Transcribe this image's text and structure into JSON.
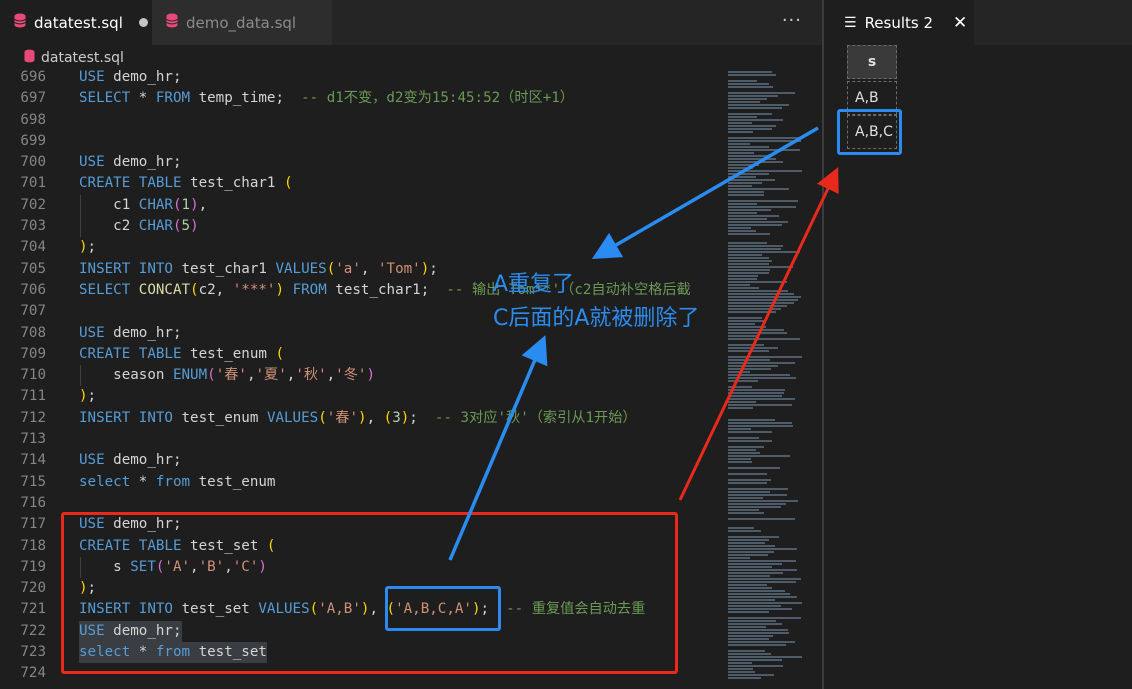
{
  "tabs": [
    {
      "label": "datatest.sql",
      "active": true,
      "modified": true
    },
    {
      "label": "demo_data.sql",
      "active": false,
      "modified": false
    }
  ],
  "breadcrumb": "datatest.sql",
  "more_label": "···",
  "editor_lines": [
    {
      "n": "696",
      "tokens": [
        [
          "kw",
          "USE"
        ],
        [
          "id",
          " demo_hr;"
        ]
      ]
    },
    {
      "n": "697",
      "tokens": [
        [
          "kw",
          "SELECT"
        ],
        [
          "id",
          " * "
        ],
        [
          "kw",
          "FROM"
        ],
        [
          "id",
          " temp_time;  "
        ],
        [
          "cm",
          "-- d1不变，d2变为15:45:52（时区+1）"
        ]
      ]
    },
    {
      "n": "698",
      "tokens": []
    },
    {
      "n": "699",
      "tokens": []
    },
    {
      "n": "700",
      "tokens": [
        [
          "kw",
          "USE"
        ],
        [
          "id",
          " demo_hr;"
        ]
      ]
    },
    {
      "n": "701",
      "tokens": [
        [
          "kw",
          "CREATE TABLE"
        ],
        [
          "id",
          " test_char1 "
        ],
        [
          "p1",
          "("
        ]
      ]
    },
    {
      "n": "702",
      "guide": true,
      "tokens": [
        [
          "id",
          "    c1 "
        ],
        [
          "kw",
          "CHAR"
        ],
        [
          "p2",
          "("
        ],
        [
          "num",
          "1"
        ],
        [
          "p2",
          ")"
        ],
        [
          "id",
          ","
        ]
      ]
    },
    {
      "n": "703",
      "guide": true,
      "tokens": [
        [
          "id",
          "    c2 "
        ],
        [
          "kw",
          "CHAR"
        ],
        [
          "p2",
          "("
        ],
        [
          "num",
          "5"
        ],
        [
          "p2",
          ")"
        ]
      ]
    },
    {
      "n": "704",
      "tokens": [
        [
          "p1",
          ")"
        ],
        [
          "id",
          ";"
        ]
      ]
    },
    {
      "n": "705",
      "tokens": [
        [
          "kw",
          "INSERT INTO"
        ],
        [
          "id",
          " test_char1 "
        ],
        [
          "kw",
          "VALUES"
        ],
        [
          "p1",
          "("
        ],
        [
          "str",
          "'a'"
        ],
        [
          "id",
          ", "
        ],
        [
          "str",
          "'Tom'"
        ],
        [
          "p1",
          ")"
        ],
        [
          "id",
          ";"
        ]
      ]
    },
    {
      "n": "706",
      "tokens": [
        [
          "kw",
          "SELECT"
        ],
        [
          "id",
          " "
        ],
        [
          "fn",
          "CONCAT"
        ],
        [
          "p1",
          "("
        ],
        [
          "id",
          "c2, "
        ],
        [
          "str",
          "'***'"
        ],
        [
          "p1",
          ")"
        ],
        [
          "id",
          " "
        ],
        [
          "kw",
          "FROM"
        ],
        [
          "id",
          " test_char1;  "
        ],
        [
          "cm",
          "-- 输出'Tom**'（c2自动补空格后截"
        ]
      ]
    },
    {
      "n": "707",
      "tokens": []
    },
    {
      "n": "708",
      "tokens": [
        [
          "kw",
          "USE"
        ],
        [
          "id",
          " demo_hr;"
        ]
      ]
    },
    {
      "n": "709",
      "tokens": [
        [
          "kw",
          "CREATE TABLE"
        ],
        [
          "id",
          " test_enum "
        ],
        [
          "p1",
          "("
        ]
      ]
    },
    {
      "n": "710",
      "guide": true,
      "tokens": [
        [
          "id",
          "    season "
        ],
        [
          "kw",
          "ENUM"
        ],
        [
          "p2",
          "("
        ],
        [
          "str",
          "'春'"
        ],
        [
          "id",
          ","
        ],
        [
          "str",
          "'夏'"
        ],
        [
          "id",
          ","
        ],
        [
          "str",
          "'秋'"
        ],
        [
          "id",
          ","
        ],
        [
          "str",
          "'冬'"
        ],
        [
          "p2",
          ")"
        ]
      ]
    },
    {
      "n": "711",
      "tokens": [
        [
          "p1",
          ")"
        ],
        [
          "id",
          ";"
        ]
      ]
    },
    {
      "n": "712",
      "tokens": [
        [
          "kw",
          "INSERT INTO"
        ],
        [
          "id",
          " test_enum "
        ],
        [
          "kw",
          "VALUES"
        ],
        [
          "p1",
          "("
        ],
        [
          "str",
          "'春'"
        ],
        [
          "p1",
          ")"
        ],
        [
          "id",
          ", "
        ],
        [
          "p1",
          "("
        ],
        [
          "num",
          "3"
        ],
        [
          "p1",
          ")"
        ],
        [
          "id",
          ";  "
        ],
        [
          "cm",
          "-- 3对应'秋'（索引从1开始）"
        ]
      ]
    },
    {
      "n": "713",
      "tokens": []
    },
    {
      "n": "714",
      "tokens": [
        [
          "kw",
          "USE"
        ],
        [
          "id",
          " demo_hr;"
        ]
      ]
    },
    {
      "n": "715",
      "tokens": [
        [
          "kw",
          "select"
        ],
        [
          "id",
          " * "
        ],
        [
          "kw",
          "from"
        ],
        [
          "id",
          " test_enum"
        ]
      ]
    },
    {
      "n": "716",
      "tokens": []
    },
    {
      "n": "717",
      "tokens": [
        [
          "kw",
          "USE"
        ],
        [
          "id",
          " demo_hr;"
        ]
      ]
    },
    {
      "n": "718",
      "tokens": [
        [
          "kw",
          "CREATE TABLE"
        ],
        [
          "id",
          " test_set "
        ],
        [
          "p1",
          "("
        ]
      ]
    },
    {
      "n": "719",
      "guide": true,
      "tokens": [
        [
          "id",
          "    s "
        ],
        [
          "kw",
          "SET"
        ],
        [
          "p2",
          "("
        ],
        [
          "str",
          "'A'"
        ],
        [
          "id",
          ","
        ],
        [
          "str",
          "'B'"
        ],
        [
          "id",
          ","
        ],
        [
          "str",
          "'C'"
        ],
        [
          "p2",
          ")"
        ]
      ]
    },
    {
      "n": "720",
      "tokens": [
        [
          "p1",
          ")"
        ],
        [
          "id",
          ";"
        ]
      ]
    },
    {
      "n": "721",
      "tokens": [
        [
          "kw",
          "INSERT INTO"
        ],
        [
          "id",
          " test_set "
        ],
        [
          "kw",
          "VALUES"
        ],
        [
          "p1",
          "("
        ],
        [
          "str",
          "'A,B'"
        ],
        [
          "p1",
          ")"
        ],
        [
          "id",
          ", "
        ],
        [
          "p1",
          "("
        ],
        [
          "str",
          "'A,B,C,A'"
        ],
        [
          "p1",
          ")"
        ],
        [
          "id",
          ";  "
        ],
        [
          "cm",
          "-- 重复值会自动去重"
        ]
      ]
    },
    {
      "n": "722",
      "selected": true,
      "tokens": [
        [
          "kw",
          "USE"
        ],
        [
          "id",
          " demo_hr;"
        ]
      ]
    },
    {
      "n": "723",
      "selected": true,
      "tokens": [
        [
          "kw",
          "select"
        ],
        [
          "id",
          " * "
        ],
        [
          "kw",
          "from"
        ],
        [
          "id",
          " test_set"
        ]
      ]
    },
    {
      "n": "724",
      "tokens": []
    }
  ],
  "results": {
    "tab_label": "Results 2",
    "close_label": "✕",
    "column": "s",
    "rows": [
      "A,B",
      "A,B,C"
    ]
  },
  "annotations": {
    "line1": "A重复了",
    "line2": "C后面的A就被删除了"
  },
  "colors": {
    "annotation_blue": "#2a8cf0",
    "annotation_red": "#e8291c",
    "accent_file": "#e8497b"
  }
}
